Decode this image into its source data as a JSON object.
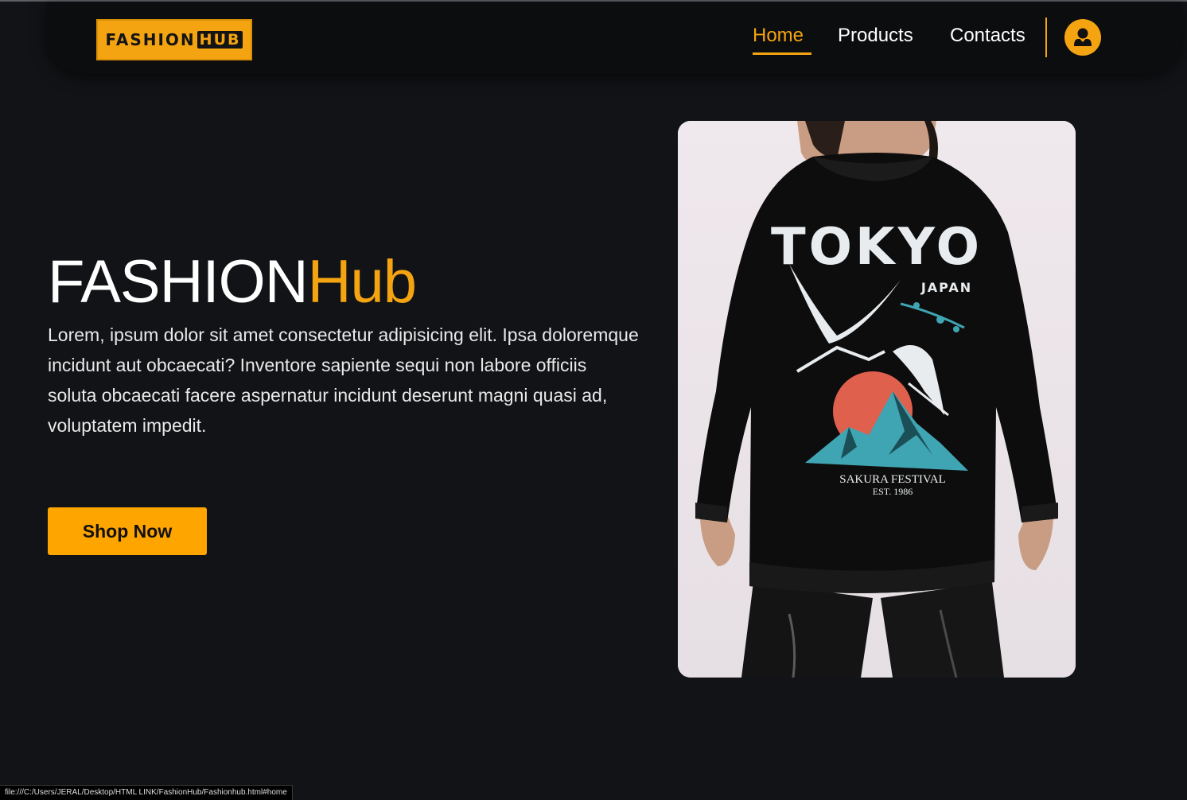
{
  "nav": {
    "logo": {
      "text_main": "FASHION",
      "text_badge": "HUB"
    },
    "links": [
      {
        "label": "Home",
        "active": true
      },
      {
        "label": "Products",
        "active": false
      },
      {
        "label": "Contacts",
        "active": false
      }
    ],
    "user_icon": "user-icon"
  },
  "hero": {
    "title_main": "FASHION",
    "title_accent": "Hub",
    "description": "Lorem, ipsum dolor sit amet consectetur adipisicing elit. Ipsa doloremque incidunt aut obcaecati? Inventore sapiente sequi non labore officiis soluta obcaecati facere aspernatur incidunt deserunt magni quasi ad, voluptatem impedit.",
    "button_label": "Shop Now"
  },
  "product_image": {
    "print_title": "TOKYO",
    "print_subtitle": "JAPAN",
    "print_caption": "SAKURA FESTIVAL",
    "print_est": "EST. 1986"
  },
  "status_bar": {
    "url": "file:///C:/Users/JERAL/Desktop/HTML LINK/FashionHub/Fashionhub.html#home"
  },
  "colors": {
    "accent": "#f5a411",
    "background": "#111316",
    "navbar": "#0c0d0f",
    "text": "#ffffff"
  }
}
